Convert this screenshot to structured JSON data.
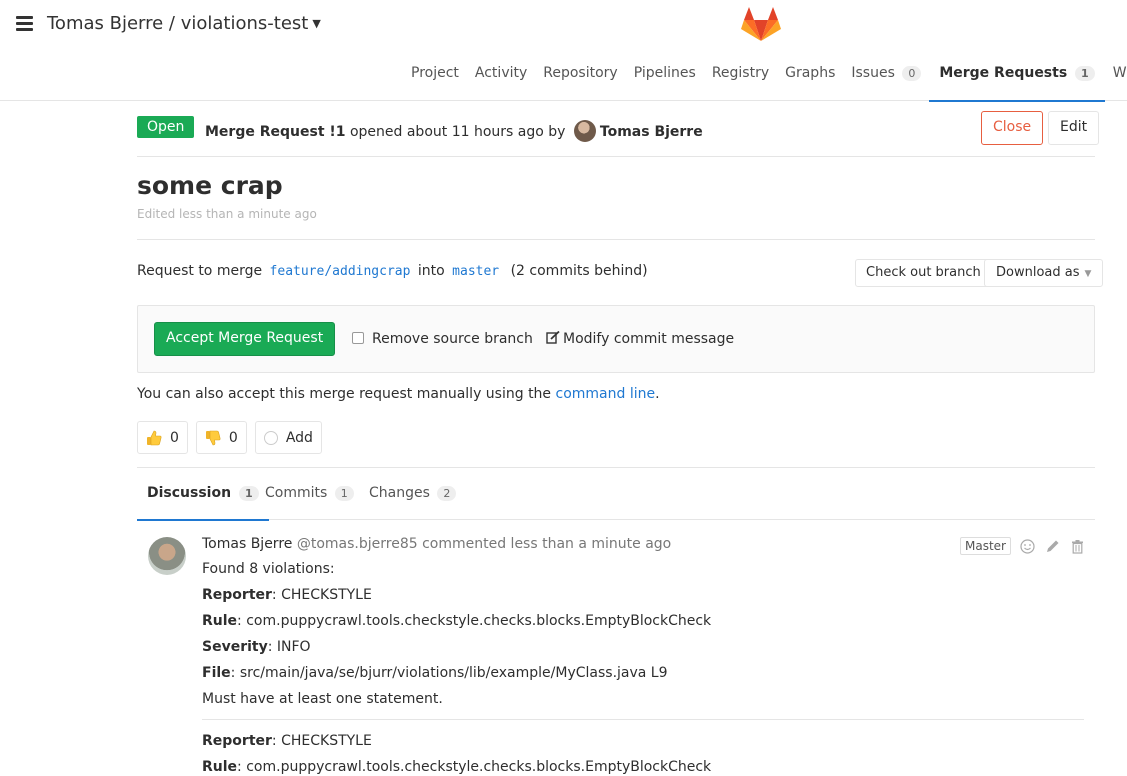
{
  "header": {
    "project_title": "Tomas Bjerre / violations-test",
    "nav": [
      {
        "label": "Project"
      },
      {
        "label": "Activity"
      },
      {
        "label": "Repository"
      },
      {
        "label": "Pipelines"
      },
      {
        "label": "Registry"
      },
      {
        "label": "Graphs"
      },
      {
        "label": "Issues",
        "count": "0"
      },
      {
        "label": "Merge Requests",
        "count": "1",
        "active": true
      },
      {
        "label": "Wiki"
      }
    ]
  },
  "mr": {
    "status": "Open",
    "ref": "Merge Request !1",
    "opened_text": "opened about 11 hours ago by",
    "author": "Tomas Bjerre",
    "close_label": "Close",
    "edit_label": "Edit",
    "title": "some crap",
    "edited": "Edited less than a minute ago",
    "merge_prefix": "Request to merge",
    "source_branch": "feature/addingcrap",
    "into": "into",
    "target_branch": "master",
    "behind": "(2 commits behind)",
    "checkout_label": "Check out branch",
    "download_label": "Download as",
    "accept_label": "Accept Merge Request",
    "remove_source_label": "Remove source branch",
    "modify_label": "Modify commit message",
    "manual_prefix": "You can also accept this merge request manually using the",
    "manual_link": "command line",
    "manual_suffix": ".",
    "thumbsup_count": "0",
    "thumbsdown_count": "0",
    "add_award_label": "Add"
  },
  "discussion_tabs": [
    {
      "label": "Discussion",
      "count": "1",
      "active": true
    },
    {
      "label": "Commits",
      "count": "1"
    },
    {
      "label": "Changes",
      "count": "2"
    }
  ],
  "note": {
    "author": "Tomas Bjerre",
    "handle": "@tomas.bjerre85",
    "time": "commented less than a minute ago",
    "role": "Master",
    "intro": "Found 8 violations:",
    "violations": [
      {
        "reporter_label": "Reporter",
        "reporter": ": CHECKSTYLE",
        "rule_label": "Rule",
        "rule": ": com.puppycrawl.tools.checkstyle.checks.blocks.EmptyBlockCheck",
        "severity_label": "Severity",
        "severity": ": INFO",
        "file_label": "File",
        "file": ": src/main/java/se/bjurr/violations/lib/example/MyClass.java L9",
        "message": "Must have at least one statement."
      },
      {
        "reporter_label": "Reporter",
        "reporter": ": CHECKSTYLE",
        "rule_label": "Rule",
        "rule": ": com.puppycrawl.tools.checkstyle.checks.blocks.EmptyBlockCheck"
      }
    ]
  },
  "colors": {
    "green": "#1aaa55",
    "link": "#1f78d1",
    "close": "#e75e40"
  }
}
